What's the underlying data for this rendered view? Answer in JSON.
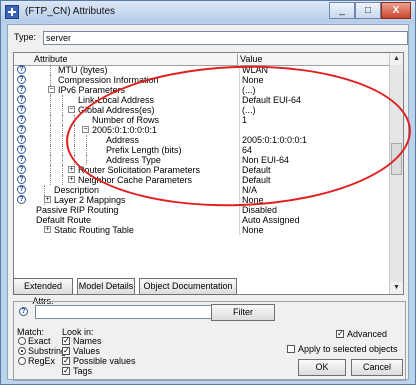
{
  "window": {
    "title": "(FTP_CN) Attributes",
    "minimize": "_",
    "maximize": "□",
    "close": "X"
  },
  "type": {
    "label": "Type:",
    "value": "server"
  },
  "grid": {
    "col_attribute": "Attribute",
    "col_value": "Value",
    "rows": [
      {
        "name": "MTU (bytes)",
        "value": "WLAN"
      },
      {
        "name": "Compression Information",
        "value": "None"
      },
      {
        "name": "IPv6 Parameters",
        "value": "(...)"
      },
      {
        "name": "Link-Local Address",
        "value": "Default EUI-64"
      },
      {
        "name": "Global Address(es)",
        "value": "(...)"
      },
      {
        "name": "Number of Rows",
        "value": "1"
      },
      {
        "name": "2005:0:1:0:0:0:1",
        "value": ""
      },
      {
        "name": "Address",
        "value": "2005:0:1:0:0:0:1"
      },
      {
        "name": "Prefix Length (bits)",
        "value": "64"
      },
      {
        "name": "Address Type",
        "value": "Non EUI-64"
      },
      {
        "name": "Router Solicitation Parameters",
        "value": "Default"
      },
      {
        "name": "Neighbor Cache Parameters",
        "value": "Default"
      },
      {
        "name": "Description",
        "value": "N/A"
      },
      {
        "name": "Layer 2 Mappings",
        "value": "None"
      },
      {
        "name": "Passive RIP Routing",
        "value": "Disabled"
      },
      {
        "name": "Default Route",
        "value": "Auto Assigned"
      },
      {
        "name": "Static Routing Table",
        "value": "None"
      }
    ]
  },
  "buttons": {
    "extended": "Extended Attrs.",
    "model_details": "Model Details",
    "object_doc": "Object Documentation",
    "filter": "Filter",
    "ok": "OK",
    "cancel": "Cancel"
  },
  "filter": {
    "match_label": "Match:",
    "match_options": [
      "Exact",
      "Substring",
      "RegEx"
    ],
    "lookin_label": "Look in:",
    "lookin_options": [
      "Names",
      "Values",
      "Possible values",
      "Tags"
    ],
    "advanced": "Advanced",
    "apply_selected": "Apply to selected objects"
  },
  "colors": {
    "annotation": "#e02020",
    "title_bg": "#bcd3ee"
  }
}
